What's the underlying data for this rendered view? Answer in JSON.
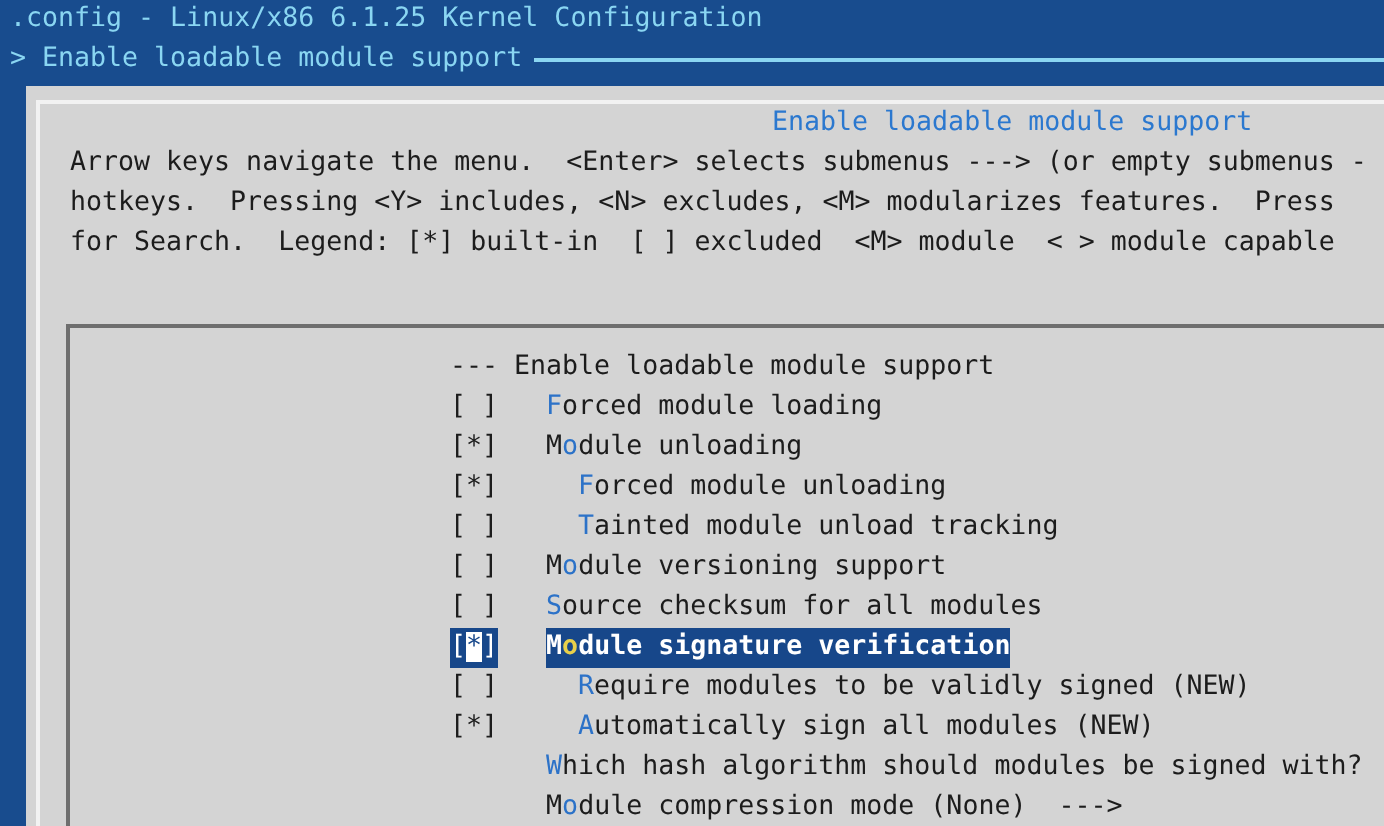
{
  "window": {
    "title": ".config - Linux/x86 6.1.25 Kernel Configuration"
  },
  "breadcrumb": "> Enable loadable module support",
  "dialog": {
    "title": "Enable loadable module support",
    "help_lines": [
      "Arrow keys navigate the menu.  <Enter> selects submenus ---> (or empty submenus -",
      "hotkeys.  Pressing <Y> includes, <N> excludes, <M> modularizes features.  Press",
      "for Search.  Legend: [*] built-in  [ ] excluded  <M> module  < > module capable"
    ],
    "checkbox_glyphs": {
      "open": "[",
      "mark": "*",
      "close": "]"
    },
    "menu": [
      {
        "kind": "heading",
        "text": "--- Enable loadable module support"
      },
      {
        "kind": "option",
        "checked": false,
        "hotkey": "F",
        "rest": "orced module loading",
        "selected": false
      },
      {
        "kind": "option",
        "checked": true,
        "pre": "M",
        "hotkey": "o",
        "rest": "dule unloading",
        "selected": false,
        "children": [
          {
            "kind": "option",
            "checked": true,
            "hotkey": "F",
            "rest": "orced module unloading",
            "selected": false
          },
          {
            "kind": "option",
            "checked": false,
            "hotkey": "T",
            "rest": "ainted module unload tracking",
            "selected": false
          }
        ]
      },
      {
        "kind": "option",
        "checked": false,
        "pre": "M",
        "hotkey": "o",
        "rest": "dule versioning support",
        "selected": false
      },
      {
        "kind": "option",
        "checked": false,
        "hotkey": "S",
        "rest": "ource checksum for all modules",
        "selected": false
      },
      {
        "kind": "option",
        "checked": true,
        "pre": "M",
        "hotkey": "o",
        "rest": "dule signature verification",
        "selected": true,
        "children": [
          {
            "kind": "option",
            "checked": false,
            "hotkey": "R",
            "rest": "equire modules to be validly signed (NEW)",
            "selected": false
          },
          {
            "kind": "option",
            "checked": true,
            "hotkey": "A",
            "rest": "utomatically sign all modules (NEW)",
            "selected": false
          }
        ]
      },
      {
        "kind": "choice",
        "hotkey": "W",
        "rest": "hich hash algorithm should modules be signed with?",
        "selected": false
      },
      {
        "kind": "choice",
        "pre": "M",
        "hotkey": "o",
        "rest": "dule compression mode (None)  --->",
        "selected": false
      }
    ]
  }
}
